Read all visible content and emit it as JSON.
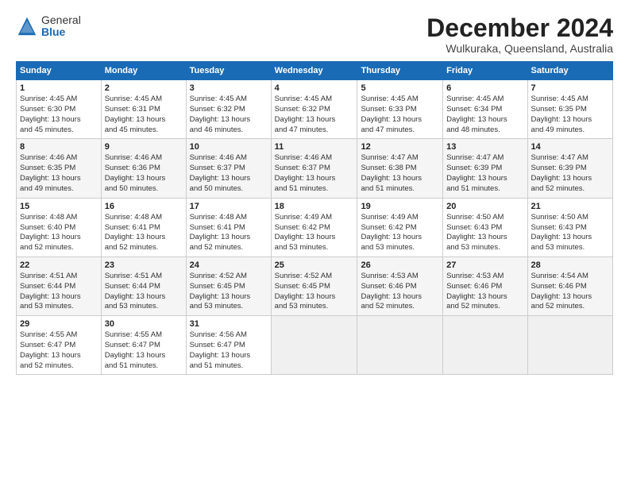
{
  "logo": {
    "general": "General",
    "blue": "Blue"
  },
  "title": "December 2024",
  "location": "Wulkuraka, Queensland, Australia",
  "days_header": [
    "Sunday",
    "Monday",
    "Tuesday",
    "Wednesday",
    "Thursday",
    "Friday",
    "Saturday"
  ],
  "weeks": [
    [
      {
        "day": "1",
        "info": "Sunrise: 4:45 AM\nSunset: 6:30 PM\nDaylight: 13 hours\nand 45 minutes."
      },
      {
        "day": "2",
        "info": "Sunrise: 4:45 AM\nSunset: 6:31 PM\nDaylight: 13 hours\nand 45 minutes."
      },
      {
        "day": "3",
        "info": "Sunrise: 4:45 AM\nSunset: 6:32 PM\nDaylight: 13 hours\nand 46 minutes."
      },
      {
        "day": "4",
        "info": "Sunrise: 4:45 AM\nSunset: 6:32 PM\nDaylight: 13 hours\nand 47 minutes."
      },
      {
        "day": "5",
        "info": "Sunrise: 4:45 AM\nSunset: 6:33 PM\nDaylight: 13 hours\nand 47 minutes."
      },
      {
        "day": "6",
        "info": "Sunrise: 4:45 AM\nSunset: 6:34 PM\nDaylight: 13 hours\nand 48 minutes."
      },
      {
        "day": "7",
        "info": "Sunrise: 4:45 AM\nSunset: 6:35 PM\nDaylight: 13 hours\nand 49 minutes."
      }
    ],
    [
      {
        "day": "8",
        "info": "Sunrise: 4:46 AM\nSunset: 6:35 PM\nDaylight: 13 hours\nand 49 minutes."
      },
      {
        "day": "9",
        "info": "Sunrise: 4:46 AM\nSunset: 6:36 PM\nDaylight: 13 hours\nand 50 minutes."
      },
      {
        "day": "10",
        "info": "Sunrise: 4:46 AM\nSunset: 6:37 PM\nDaylight: 13 hours\nand 50 minutes."
      },
      {
        "day": "11",
        "info": "Sunrise: 4:46 AM\nSunset: 6:37 PM\nDaylight: 13 hours\nand 51 minutes."
      },
      {
        "day": "12",
        "info": "Sunrise: 4:47 AM\nSunset: 6:38 PM\nDaylight: 13 hours\nand 51 minutes."
      },
      {
        "day": "13",
        "info": "Sunrise: 4:47 AM\nSunset: 6:39 PM\nDaylight: 13 hours\nand 51 minutes."
      },
      {
        "day": "14",
        "info": "Sunrise: 4:47 AM\nSunset: 6:39 PM\nDaylight: 13 hours\nand 52 minutes."
      }
    ],
    [
      {
        "day": "15",
        "info": "Sunrise: 4:48 AM\nSunset: 6:40 PM\nDaylight: 13 hours\nand 52 minutes."
      },
      {
        "day": "16",
        "info": "Sunrise: 4:48 AM\nSunset: 6:41 PM\nDaylight: 13 hours\nand 52 minutes."
      },
      {
        "day": "17",
        "info": "Sunrise: 4:48 AM\nSunset: 6:41 PM\nDaylight: 13 hours\nand 52 minutes."
      },
      {
        "day": "18",
        "info": "Sunrise: 4:49 AM\nSunset: 6:42 PM\nDaylight: 13 hours\nand 53 minutes."
      },
      {
        "day": "19",
        "info": "Sunrise: 4:49 AM\nSunset: 6:42 PM\nDaylight: 13 hours\nand 53 minutes."
      },
      {
        "day": "20",
        "info": "Sunrise: 4:50 AM\nSunset: 6:43 PM\nDaylight: 13 hours\nand 53 minutes."
      },
      {
        "day": "21",
        "info": "Sunrise: 4:50 AM\nSunset: 6:43 PM\nDaylight: 13 hours\nand 53 minutes."
      }
    ],
    [
      {
        "day": "22",
        "info": "Sunrise: 4:51 AM\nSunset: 6:44 PM\nDaylight: 13 hours\nand 53 minutes."
      },
      {
        "day": "23",
        "info": "Sunrise: 4:51 AM\nSunset: 6:44 PM\nDaylight: 13 hours\nand 53 minutes."
      },
      {
        "day": "24",
        "info": "Sunrise: 4:52 AM\nSunset: 6:45 PM\nDaylight: 13 hours\nand 53 minutes."
      },
      {
        "day": "25",
        "info": "Sunrise: 4:52 AM\nSunset: 6:45 PM\nDaylight: 13 hours\nand 53 minutes."
      },
      {
        "day": "26",
        "info": "Sunrise: 4:53 AM\nSunset: 6:46 PM\nDaylight: 13 hours\nand 52 minutes."
      },
      {
        "day": "27",
        "info": "Sunrise: 4:53 AM\nSunset: 6:46 PM\nDaylight: 13 hours\nand 52 minutes."
      },
      {
        "day": "28",
        "info": "Sunrise: 4:54 AM\nSunset: 6:46 PM\nDaylight: 13 hours\nand 52 minutes."
      }
    ],
    [
      {
        "day": "29",
        "info": "Sunrise: 4:55 AM\nSunset: 6:47 PM\nDaylight: 13 hours\nand 52 minutes."
      },
      {
        "day": "30",
        "info": "Sunrise: 4:55 AM\nSunset: 6:47 PM\nDaylight: 13 hours\nand 51 minutes."
      },
      {
        "day": "31",
        "info": "Sunrise: 4:56 AM\nSunset: 6:47 PM\nDaylight: 13 hours\nand 51 minutes."
      },
      {
        "day": "",
        "info": ""
      },
      {
        "day": "",
        "info": ""
      },
      {
        "day": "",
        "info": ""
      },
      {
        "day": "",
        "info": ""
      }
    ]
  ]
}
